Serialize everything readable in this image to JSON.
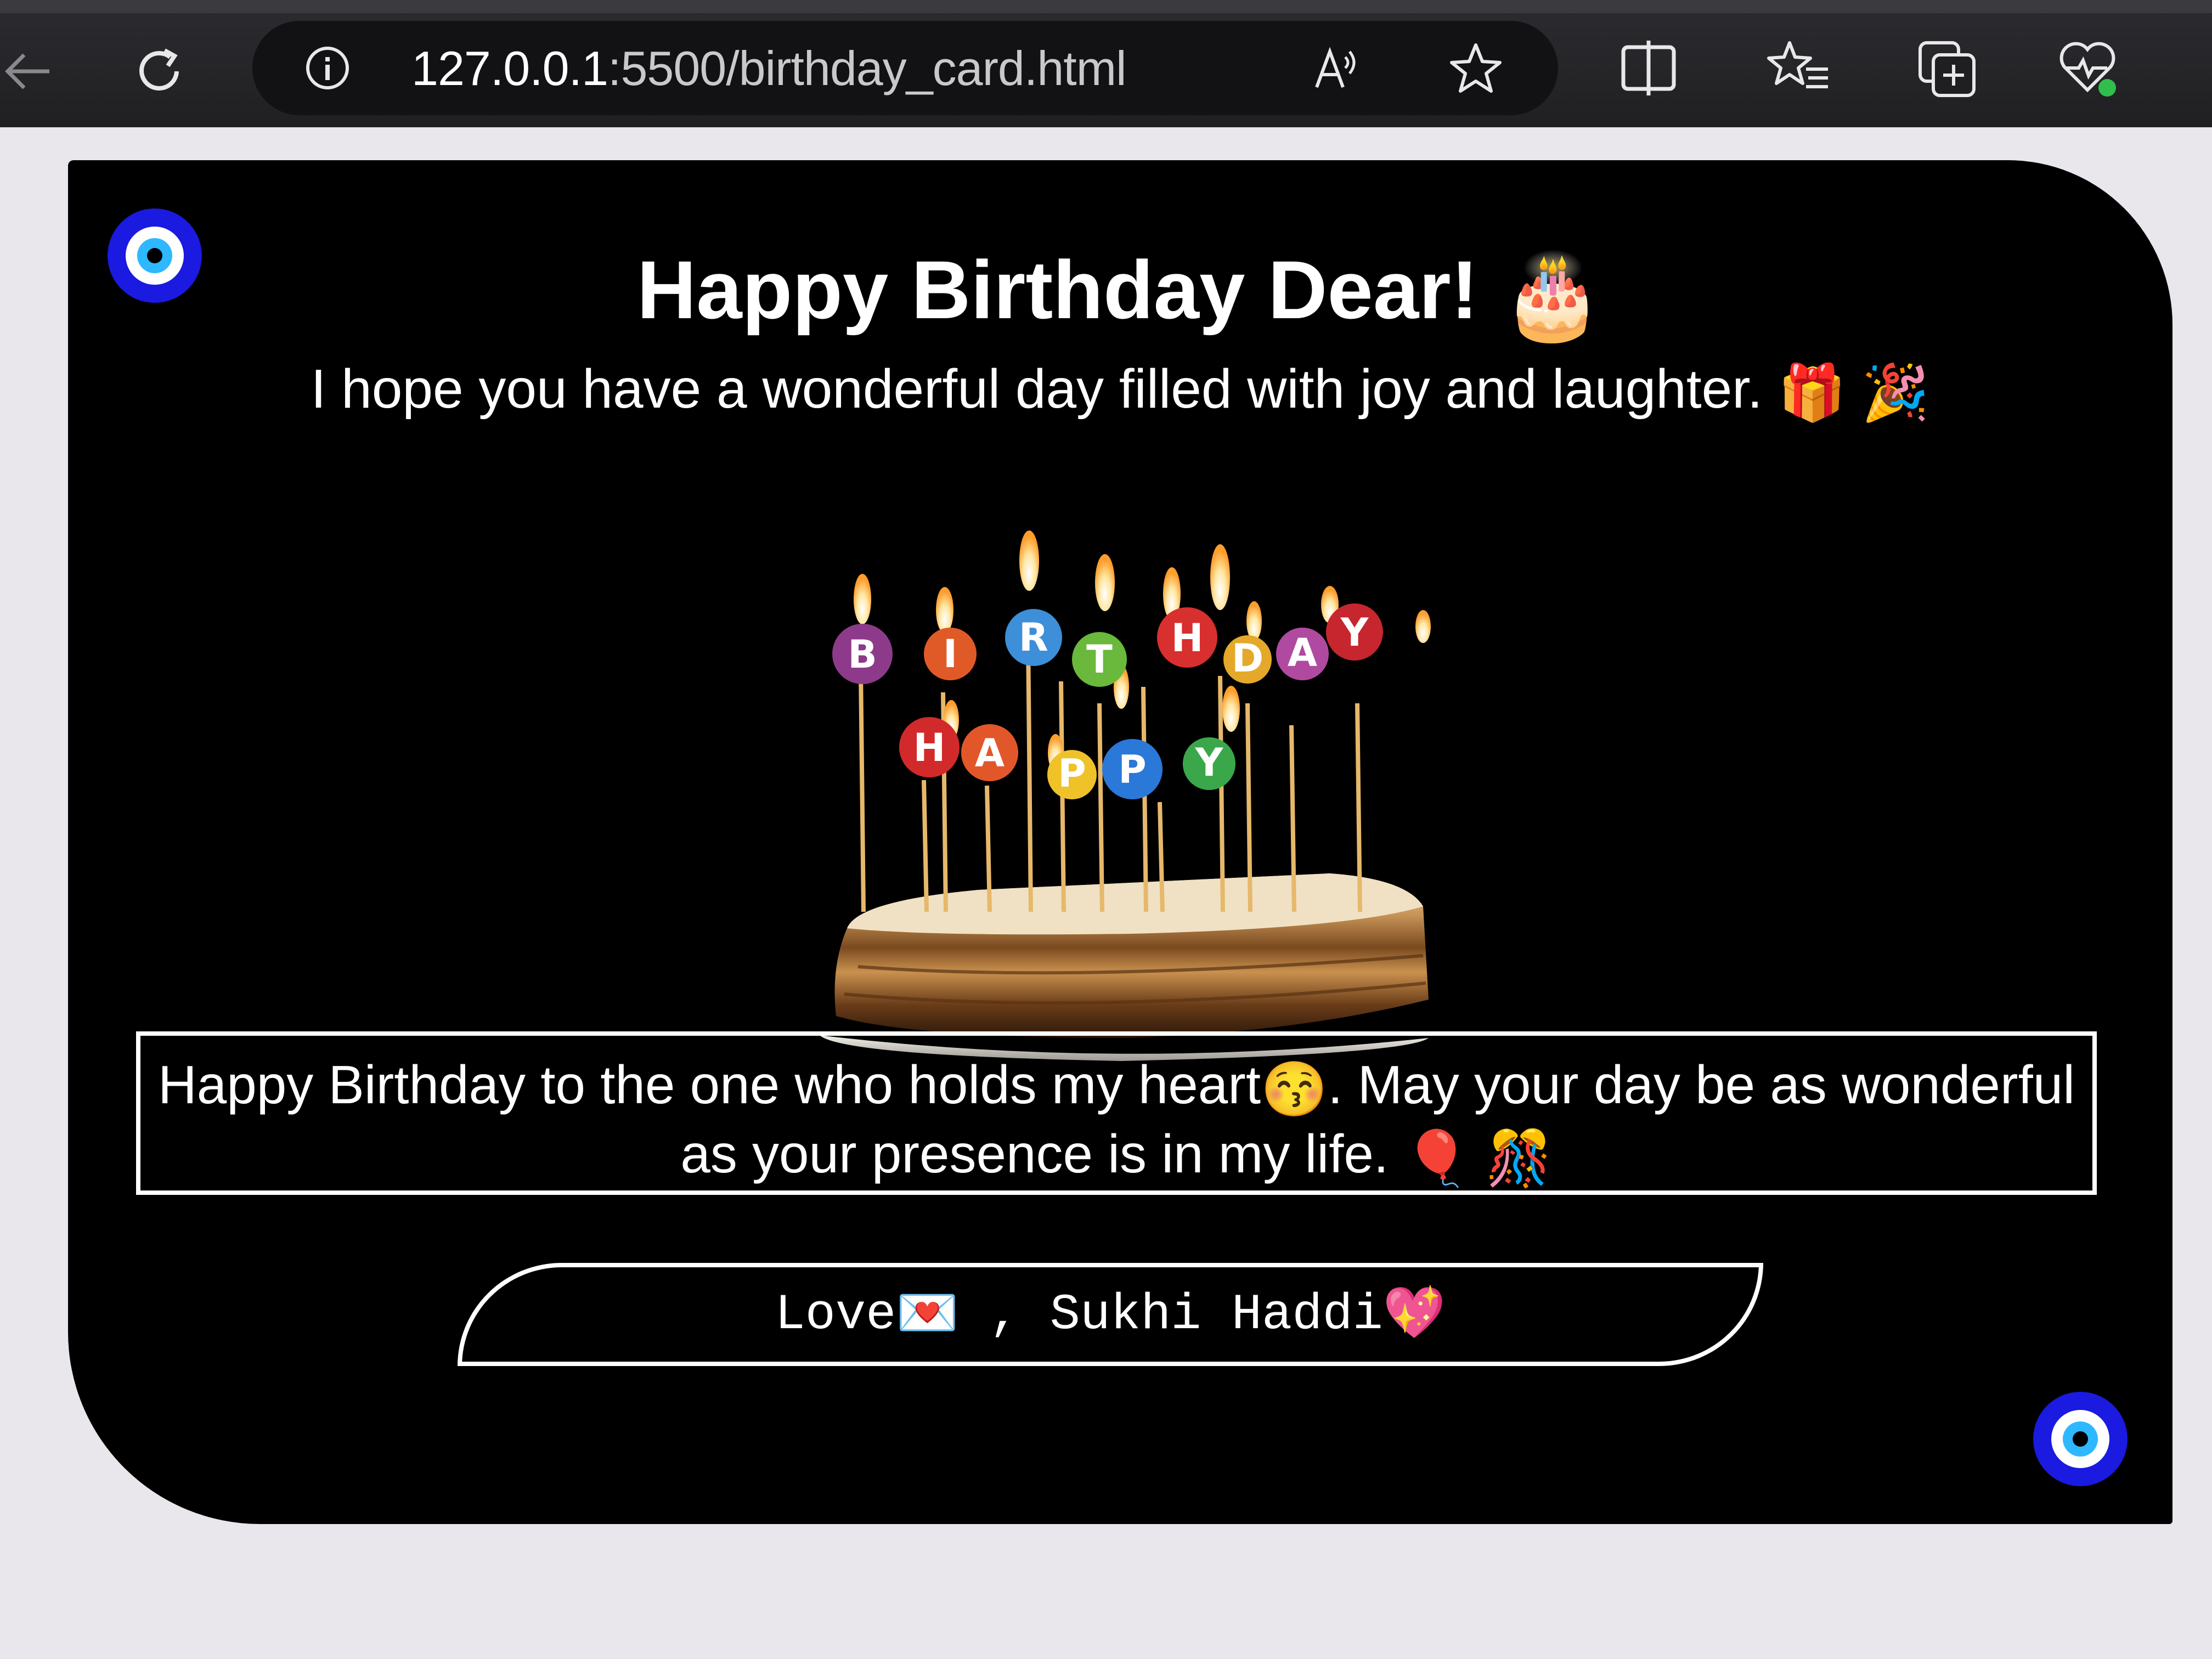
{
  "browser": {
    "url_host": "127.0.0.1",
    "url_rest": ":5500/birthday_card.html",
    "icons": [
      "back-arrow-icon",
      "refresh-icon",
      "info-icon",
      "read-aloud-icon",
      "favorite-star-icon",
      "split-screen-icon",
      "favorites-list-icon",
      "collections-icon",
      "browser-essentials-icon"
    ]
  },
  "card": {
    "title": "Happy Birthday Dear!",
    "title_emoji": "🎂",
    "subtitle": "I hope you have a wonderful day filled with joy and laughter.",
    "subtitle_emojis": "🎁 🎉",
    "cake_candle_letters": [
      "B",
      "I",
      "R",
      "T",
      "H",
      "D",
      "A",
      "Y",
      "H",
      "A",
      "P",
      "P",
      "Y"
    ],
    "message_line1_a": "Happy Birthday to the one who holds my heart",
    "message_emoji1": "😚",
    "message_line1_b": ". May your day be as wonderful",
    "message_line2": "as your presence is in my life.",
    "message_emojis2": "🎈 🎊",
    "signature_love": "Love",
    "signature_emoji1": "💌",
    "signature_sep": " , ",
    "signature_name": "Sukhi Haddi",
    "signature_emoji2": "💖",
    "colors": {
      "background": "#000000",
      "text": "#ffffff",
      "evil_eye_blue": "#1a1ae0"
    }
  }
}
